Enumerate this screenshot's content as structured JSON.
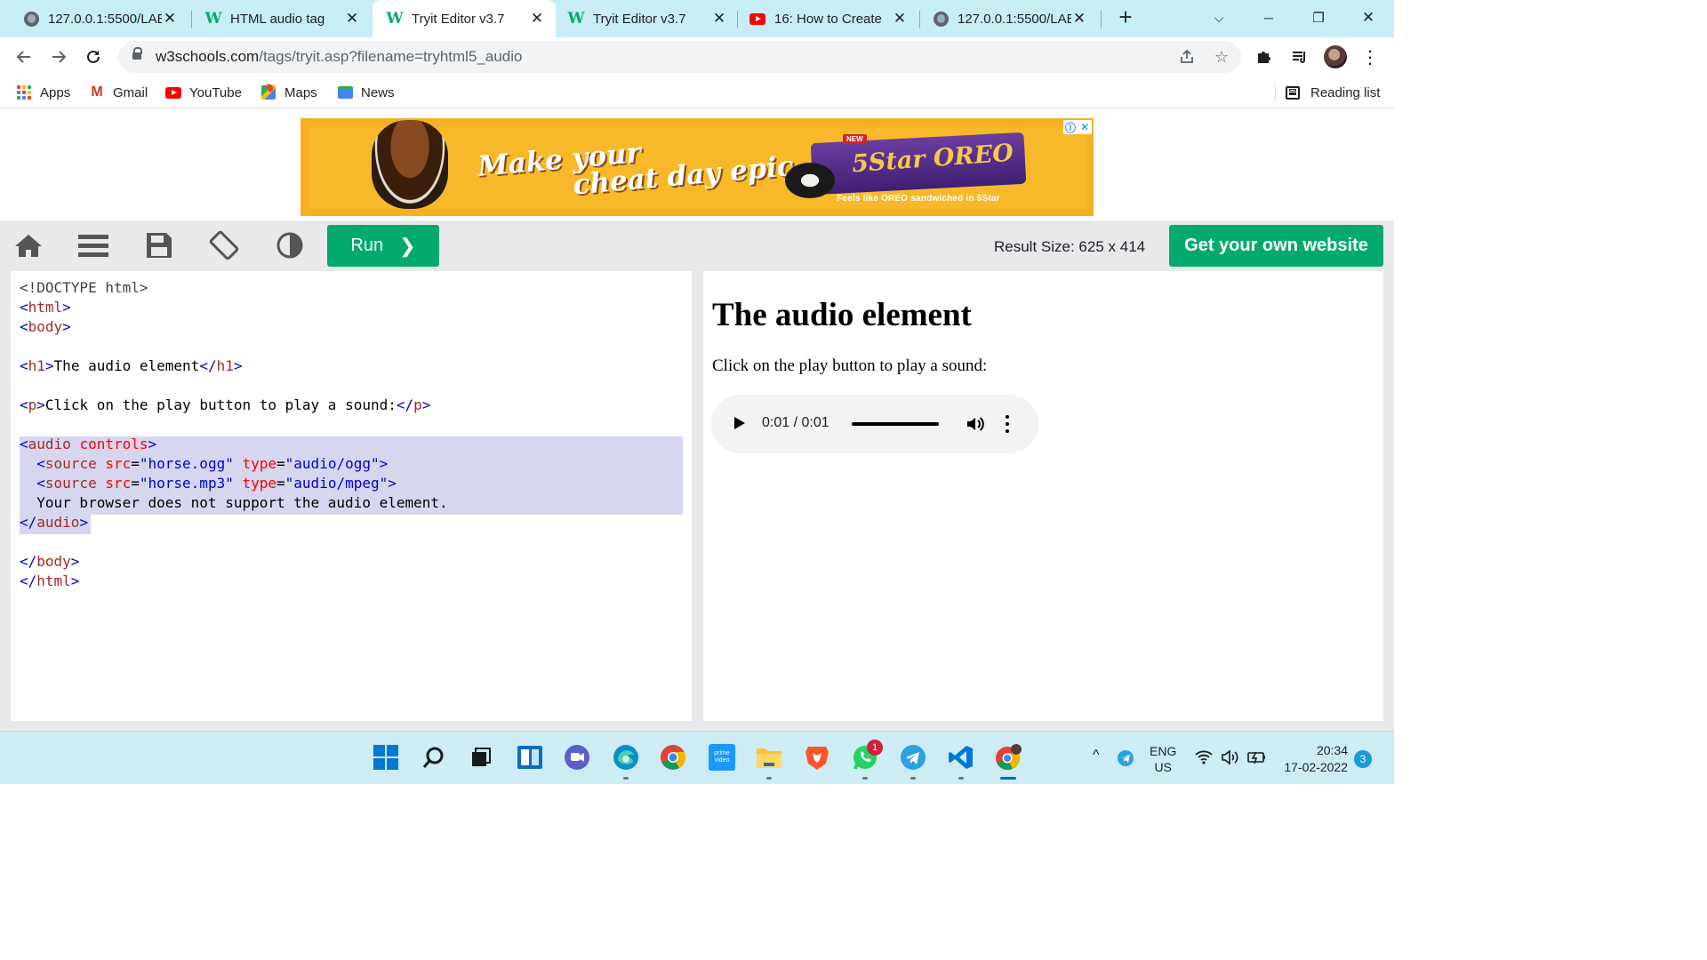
{
  "browser": {
    "tabs": [
      {
        "title": "127.0.0.1:5500/LAB",
        "icon": "globe-icon",
        "active": false
      },
      {
        "title": "HTML audio tag",
        "icon": "w3schools-icon",
        "active": false
      },
      {
        "title": "Tryit Editor v3.7",
        "icon": "w3schools-icon",
        "active": true
      },
      {
        "title": "Tryit Editor v3.7",
        "icon": "w3schools-icon",
        "active": false
      },
      {
        "title": "16: How to Create",
        "icon": "youtube-icon",
        "active": false
      },
      {
        "title": "127.0.0.1:5500/LAB",
        "icon": "globe-icon",
        "active": false
      }
    ],
    "new_tab": "+",
    "window": {
      "minimize": "─",
      "restore": "❐",
      "close": "✕",
      "dropdown": "⌵"
    },
    "address": {
      "host": "w3schools.com",
      "path": "/tags/tryit.asp?filename=tryhtml5_audio"
    },
    "bookmarks": [
      {
        "label": "Apps",
        "icon": "apps-grid-icon"
      },
      {
        "label": "Gmail",
        "icon": "gmail-icon"
      },
      {
        "label": "YouTube",
        "icon": "youtube-icon"
      },
      {
        "label": "Maps",
        "icon": "maps-icon"
      },
      {
        "label": "News",
        "icon": "news-icon"
      }
    ],
    "reading_list": "Reading list"
  },
  "ad": {
    "headline_line1": "Make your",
    "headline_line2": "cheat day epic.",
    "brand": "5Star OREO",
    "tag": "NEW",
    "tagline": "Feels like OREO sandwiched in 5Star",
    "bg_color": "#f5b024"
  },
  "tryit": {
    "run_label": "Run",
    "run_chevron": "❯",
    "result_size": "Result Size: 625 x 414",
    "get_website": "Get your own website",
    "accent": "#04aa6d",
    "icons": [
      "home-icon",
      "menu-icon",
      "save-icon",
      "rotate-icon",
      "contrast-icon"
    ]
  },
  "code_lines": [
    [
      {
        "c": "doct",
        "t": "<!DOCTYPE html>"
      }
    ],
    [
      {
        "c": "br",
        "t": "<"
      },
      {
        "c": "tag",
        "t": "html"
      },
      {
        "c": "br",
        "t": ">"
      }
    ],
    [
      {
        "c": "br",
        "t": "<"
      },
      {
        "c": "tag",
        "t": "body"
      },
      {
        "c": "br",
        "t": ">"
      }
    ],
    [],
    [
      {
        "c": "br",
        "t": "<"
      },
      {
        "c": "tag",
        "t": "h1"
      },
      {
        "c": "br",
        "t": ">"
      },
      {
        "c": "txt",
        "t": "The audio element"
      },
      {
        "c": "br",
        "t": "</"
      },
      {
        "c": "tag",
        "t": "h1"
      },
      {
        "c": "br",
        "t": ">"
      }
    ],
    [],
    [
      {
        "c": "br",
        "t": "<"
      },
      {
        "c": "tag",
        "t": "p"
      },
      {
        "c": "br",
        "t": ">"
      },
      {
        "c": "txt",
        "t": "Click on the play button to play a sound:"
      },
      {
        "c": "br",
        "t": "</"
      },
      {
        "c": "tag",
        "t": "p"
      },
      {
        "c": "br",
        "t": ">"
      }
    ],
    [],
    [
      {
        "c": "br",
        "t": "<"
      },
      {
        "c": "tag",
        "t": "audio"
      },
      {
        "c": "attr",
        "t": " controls"
      },
      {
        "c": "br",
        "t": ">"
      }
    ],
    [
      {
        "c": "txt",
        "t": "  "
      },
      {
        "c": "br",
        "t": "<"
      },
      {
        "c": "tag",
        "t": "source"
      },
      {
        "c": "attr",
        "t": " src"
      },
      {
        "c": "txt",
        "t": "="
      },
      {
        "c": "val",
        "t": "\"horse.ogg\""
      },
      {
        "c": "attr",
        "t": " type"
      },
      {
        "c": "txt",
        "t": "="
      },
      {
        "c": "val",
        "t": "\"audio/ogg\""
      },
      {
        "c": "br",
        "t": ">"
      }
    ],
    [
      {
        "c": "txt",
        "t": "  "
      },
      {
        "c": "br",
        "t": "<"
      },
      {
        "c": "tag",
        "t": "source"
      },
      {
        "c": "attr",
        "t": " src"
      },
      {
        "c": "txt",
        "t": "="
      },
      {
        "c": "val",
        "t": "\"horse.mp3\""
      },
      {
        "c": "attr",
        "t": " type"
      },
      {
        "c": "txt",
        "t": "="
      },
      {
        "c": "val",
        "t": "\"audio/mpeg\""
      },
      {
        "c": "br",
        "t": ">"
      }
    ],
    [
      {
        "c": "txt",
        "t": "  Your browser does not support the audio element."
      }
    ],
    [
      {
        "c": "br",
        "t": "</"
      },
      {
        "c": "tag",
        "t": "audio"
      },
      {
        "c": "br",
        "t": ">"
      }
    ],
    [],
    [
      {
        "c": "br",
        "t": "</"
      },
      {
        "c": "tag",
        "t": "body"
      },
      {
        "c": "br",
        "t": ">"
      }
    ],
    [
      {
        "c": "br",
        "t": "</"
      },
      {
        "c": "tag",
        "t": "html"
      },
      {
        "c": "br",
        "t": ">"
      }
    ]
  ],
  "result": {
    "heading": "The audio element",
    "paragraph": "Click on the play button to play a sound:",
    "audio": {
      "time": "0:01 / 0:01",
      "progress": 1.0
    }
  },
  "taskbar": {
    "apps": [
      "windows-start-icon",
      "search-icon",
      "task-view-icon",
      "widgets-icon",
      "teams-chat-icon",
      "edge-icon",
      "chrome-icon",
      "prime-video-icon",
      "file-explorer-icon",
      "brave-icon",
      "whatsapp-icon",
      "telegram-icon",
      "vscode-icon",
      "chrome-profile-icon"
    ],
    "whatsapp_badge": "1",
    "prime_label": "prime video",
    "lang_line1": "ENG",
    "lang_line2": "US",
    "time": "20:34",
    "date": "17-02-2022",
    "notifications": "3",
    "tray_chevron": "^"
  }
}
